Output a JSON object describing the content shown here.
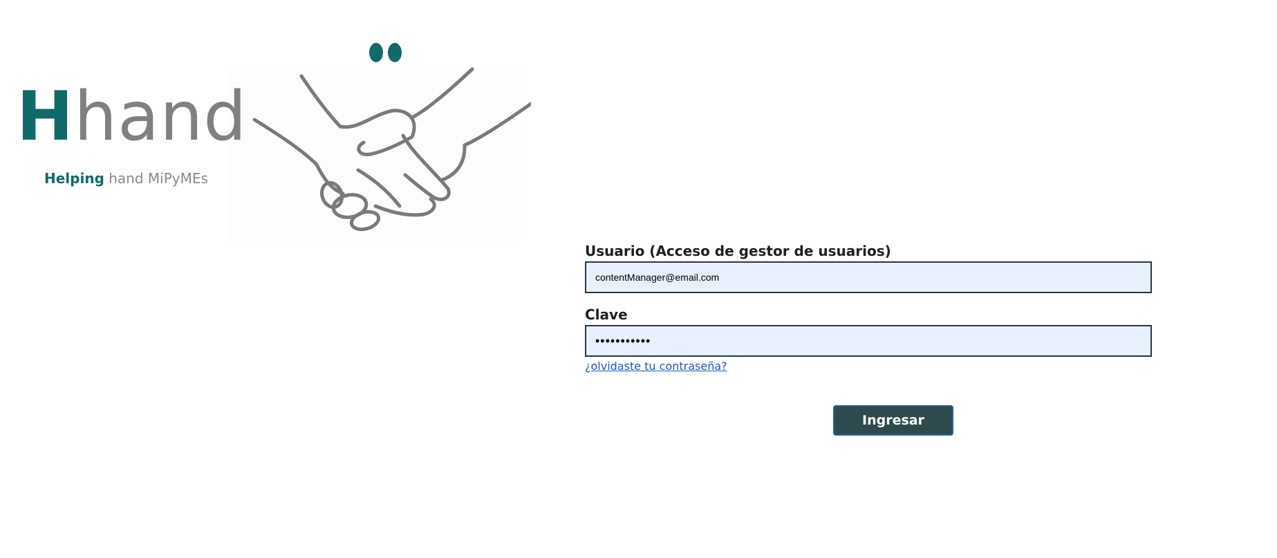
{
  "logo": {
    "letter": "H",
    "word": "hand",
    "tagline_strong": "Helping",
    "tagline_rest": " hand MiPyMEs",
    "brand_color": "#0f6a6a",
    "gray_color": "#808080"
  },
  "form": {
    "user_label": "Usuario (Acceso de gestor de usuarios)",
    "user_value": "contentManager@email.com",
    "password_label": "Clave",
    "password_value": "•••••••••••",
    "forgot_link": "¿olvidaste tu contraseña?",
    "submit_label": "Ingresar"
  },
  "colors": {
    "input_bg": "#e8f0fe",
    "input_border": "#1f3a3d",
    "button_bg": "#2e4a4c",
    "link": "#1a55c9"
  }
}
